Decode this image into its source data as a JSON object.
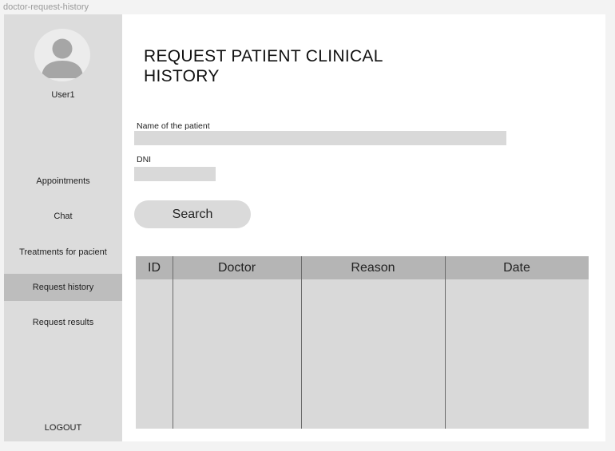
{
  "frame": {
    "label": "doctor-request-history"
  },
  "sidebar": {
    "user": {
      "name": "User1"
    },
    "items": [
      {
        "label": "Appointments",
        "active": false
      },
      {
        "label": "Chat",
        "active": false
      },
      {
        "label": "Treatments for pacient",
        "active": false
      },
      {
        "label": "Request history",
        "active": true
      },
      {
        "label": "Request results",
        "active": false
      }
    ],
    "logout_label": "LOGOUT"
  },
  "main": {
    "title": "REQUEST PATIENT CLINICAL HISTORY",
    "patient_name": {
      "label": "Name of the patient",
      "value": "",
      "placeholder": ""
    },
    "dni": {
      "label": "DNI",
      "value": "",
      "placeholder": ""
    },
    "search_label": "Search",
    "table": {
      "columns": [
        "ID",
        "Doctor",
        "Reason",
        "Date"
      ],
      "rows": []
    }
  },
  "colors": {
    "sidebar_bg": "#dcdcdc",
    "active_item_bg": "#bdbdbd",
    "table_header_bg": "#b5b5b5",
    "table_body_bg": "#d9d9d9",
    "input_bg": "#d9d9d9"
  },
  "icons": {
    "avatar": "user-avatar-icon"
  }
}
